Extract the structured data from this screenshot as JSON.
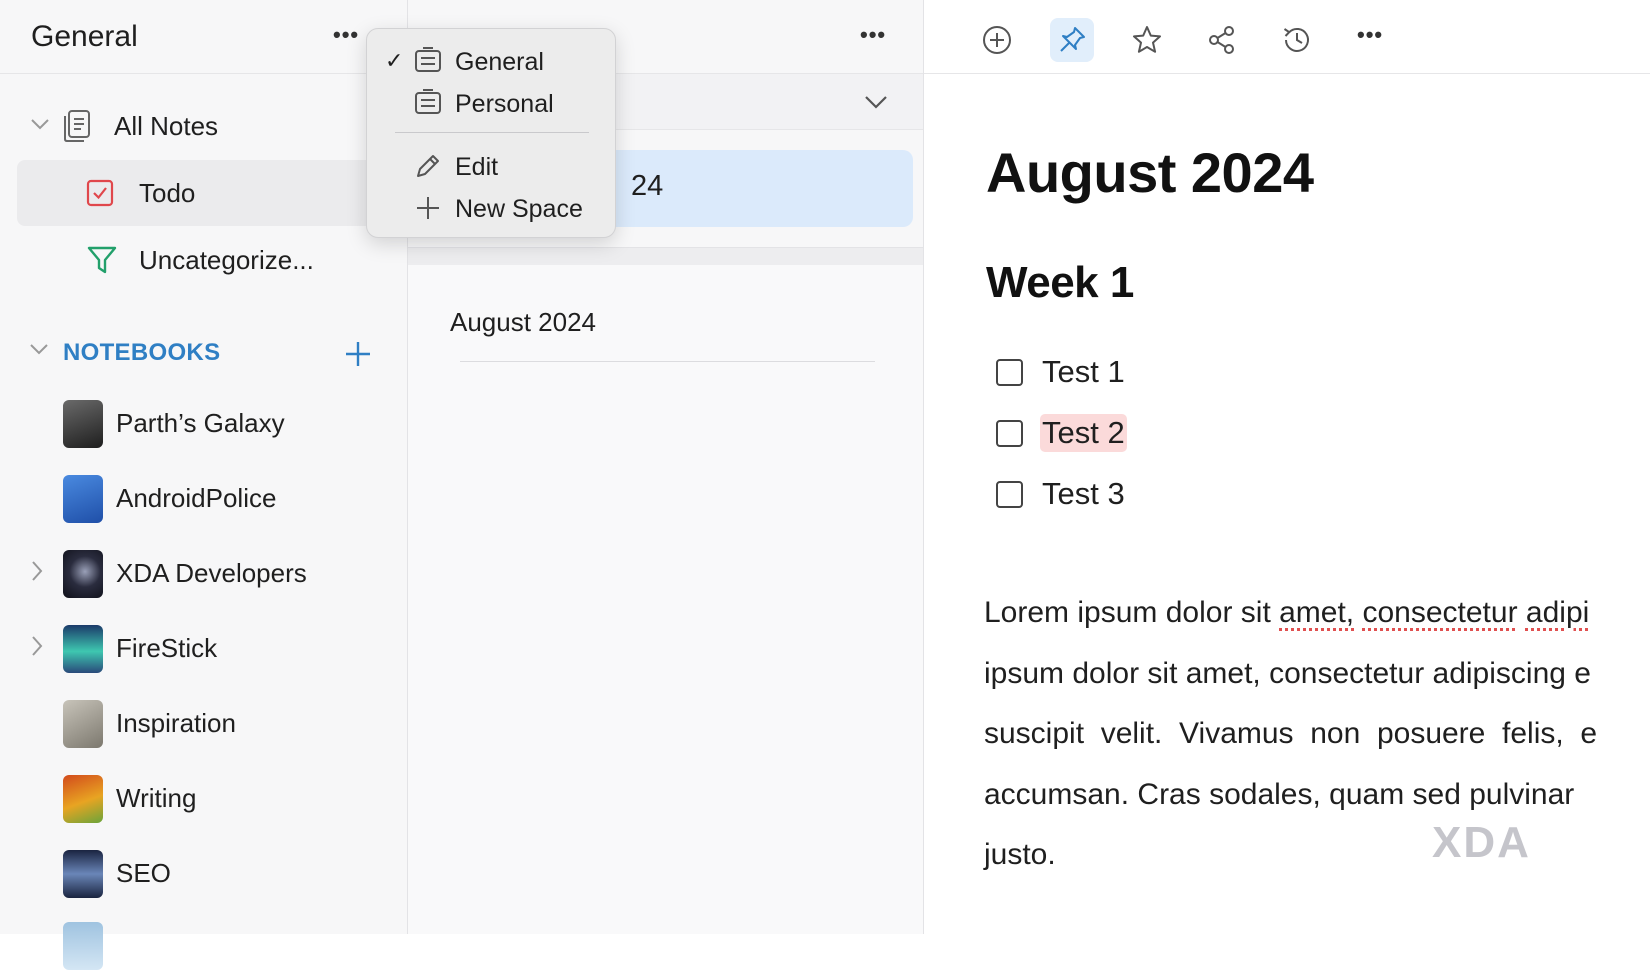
{
  "sidebar": {
    "space_title": "General",
    "more_label": "•••",
    "nav": [
      {
        "label": "All Notes",
        "icon": "notes-icon"
      },
      {
        "label": "Todo",
        "icon": "checkbox-icon"
      },
      {
        "label": "Uncategorize...",
        "icon": "filter-icon"
      }
    ],
    "notebooks_header": "NOTEBOOKS",
    "notebooks": [
      {
        "label": "Parth’s Galaxy",
        "thumb": "#3a3a3a",
        "expandable": false
      },
      {
        "label": "AndroidPolice",
        "thumb": "#2a67c7",
        "expandable": false
      },
      {
        "label": "XDA Developers",
        "thumb": "#1d1f2e",
        "expandable": true
      },
      {
        "label": "FireStick",
        "thumb": "#2fa3b8",
        "expandable": true
      },
      {
        "label": "Inspiration",
        "thumb": "#9a968c",
        "expandable": false
      },
      {
        "label": "Writing",
        "thumb": "#d86a1a",
        "expandable": false
      },
      {
        "label": "SEO",
        "thumb": "#283a5a",
        "expandable": false
      }
    ]
  },
  "space_menu": {
    "items": [
      {
        "label": "General",
        "checked": true,
        "icon": "space-icon"
      },
      {
        "label": "Personal",
        "checked": false,
        "icon": "space-icon"
      },
      {
        "label": "Edit",
        "checked": false,
        "icon": "pencil-icon"
      },
      {
        "label": "New Space",
        "checked": false,
        "icon": "plus-icon"
      }
    ],
    "check_glyph": "✓"
  },
  "list": {
    "more_label": "•••",
    "selected_note_visible": "24",
    "note_title": "August 2024"
  },
  "toolbar": {
    "more_label": "•••"
  },
  "editor": {
    "title": "August 2024",
    "heading": "Week 1",
    "todos": [
      {
        "label": "Test 1",
        "checked": false,
        "highlight": false
      },
      {
        "label": "Test 2",
        "checked": false,
        "highlight": true
      },
      {
        "label": "Test 3",
        "checked": false,
        "highlight": false
      }
    ],
    "paragraph_lines": [
      [
        "Lorem ipsum dolor sit ",
        "amet,",
        " ",
        "consectetur",
        " ",
        "adipi"
      ],
      "ipsum dolor sit amet, consectetur adipiscing e",
      "suscipit  velit.  Vivamus  non  posuere  felis,  e",
      "accumsan. Cras sodales, quam sed pulvinar",
      "justo."
    ]
  },
  "watermark": "XDA",
  "colors": {
    "accent": "#2f7fc4",
    "selected_list_bg": "#dbeafb",
    "highlight_bg": "#fbdada",
    "todo_icon_red": "#e0474c",
    "filter_icon_green": "#22a06b"
  }
}
